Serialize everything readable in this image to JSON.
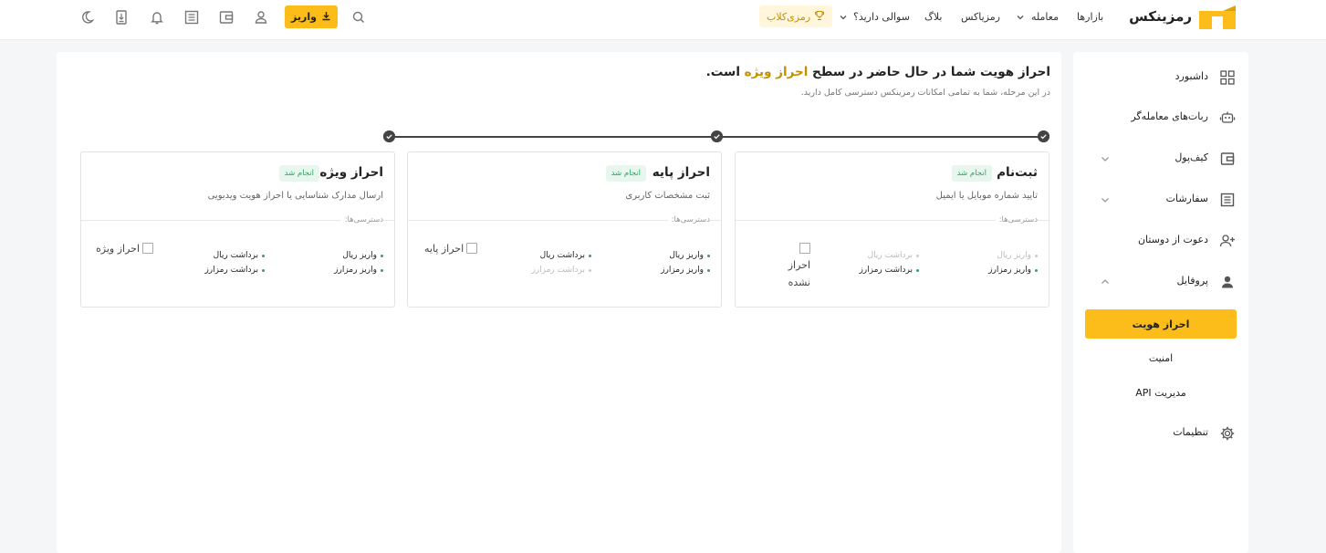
{
  "topbar": {
    "brand": "رمزینکس",
    "nav": {
      "markets": "بازارها",
      "trade": "معامله",
      "ramzinex_token": "رمزیاکس",
      "blog": "بلاگ",
      "questions": "سوالی دارید؟"
    },
    "club_label": "رمزی‌کلاب",
    "deposit_label": "واریز",
    "colors": {
      "accent": "#fcbc19",
      "club_text": "#c58f00"
    }
  },
  "sidebar": {
    "items": [
      {
        "label": "داشبورد",
        "icon": "dashboard-grid-icon"
      },
      {
        "label": "ربات‌های معامله‌گر",
        "icon": "robot-icon"
      },
      {
        "label": "کیف‌پول",
        "icon": "wallet-icon"
      },
      {
        "label": "سفارشات",
        "icon": "orders-list-icon"
      },
      {
        "label": "دعوت از دوستان",
        "icon": "add-user-icon"
      },
      {
        "label": "پروفایل",
        "icon": "user-icon"
      },
      {
        "label": "تنظیمات",
        "icon": "gear-icon"
      }
    ],
    "profile_sub": [
      {
        "label": "احراز هویت",
        "active": true
      },
      {
        "label": "امنیت",
        "active": false
      },
      {
        "label": "مدیریت API",
        "active": false
      }
    ]
  },
  "main": {
    "headline_before": "احراز هویت شما در حال حاضر در سطح",
    "headline_level": "احراز ویژه",
    "headline_after": "است.",
    "subline": "در این مرحله، شما به تمامی امکانات رمزینکس دسترسی کامل دارید.",
    "cards": [
      {
        "title": "ثبت‌نام",
        "badge": "انجام شد",
        "desc": "تایید شماره موبایل یا ایمیل",
        "access_label": "دسترسی‌ها:",
        "perms": [
          {
            "label": "واریز ریال",
            "enabled": false
          },
          {
            "label": "برداشت ریال",
            "enabled": false
          },
          {
            "label": "واریز رمزارز",
            "enabled": true
          },
          {
            "label": "برداشت رمزارز",
            "enabled": true
          }
        ],
        "image_alt": "احراز نشده"
      },
      {
        "title": "احراز پایه",
        "badge": "انجام شد",
        "desc": "ثبت مشخصات کاربری",
        "access_label": "دسترسی‌ها:",
        "perms": [
          {
            "label": "واریز ریال",
            "enabled": true
          },
          {
            "label": "برداشت ریال",
            "enabled": true
          },
          {
            "label": "واریز رمزارز",
            "enabled": true
          },
          {
            "label": "برداشت رمزارز",
            "enabled": false
          }
        ],
        "image_alt": "احراز پایه"
      },
      {
        "title": "احراز ویژه",
        "badge": "انجام شد",
        "desc": "ارسال مدارک شناسایی یا احراز هویت ویدیویی",
        "access_label": "دسترسی‌ها:",
        "perms": [
          {
            "label": "واریز ریال",
            "enabled": true
          },
          {
            "label": "برداشت ریال",
            "enabled": true
          },
          {
            "label": "واریز رمزارز",
            "enabled": true
          },
          {
            "label": "برداشت رمزارز",
            "enabled": true
          }
        ],
        "image_alt": "احراز ویژه"
      }
    ]
  }
}
